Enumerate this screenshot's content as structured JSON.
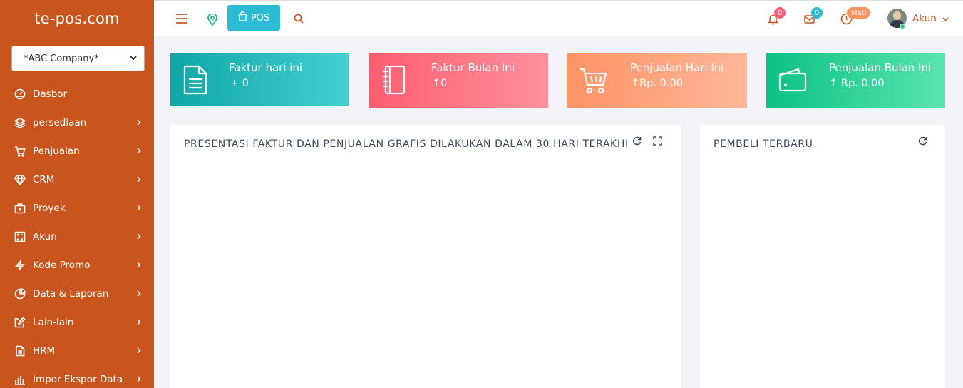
{
  "brand": "te-pos.com",
  "company_select": {
    "value": "*ABC Company*"
  },
  "sidebar": {
    "items": [
      {
        "label": "Dasbor",
        "icon": "dashboard-icon",
        "has_arrow": false
      },
      {
        "label": "persediaan",
        "icon": "layers-icon",
        "has_arrow": true
      },
      {
        "label": "Penjualan",
        "icon": "cart-icon",
        "has_arrow": true
      },
      {
        "label": "CRM",
        "icon": "diamond-icon",
        "has_arrow": true
      },
      {
        "label": "Proyek",
        "icon": "briefcase-icon",
        "has_arrow": true
      },
      {
        "label": "Akun",
        "icon": "calculator-icon",
        "has_arrow": true
      },
      {
        "label": "Kode Promo",
        "icon": "bolt-icon",
        "has_arrow": true
      },
      {
        "label": "Data & Laporan",
        "icon": "pie-chart-icon",
        "has_arrow": true
      },
      {
        "label": "Lain-lain",
        "icon": "edit-icon",
        "has_arrow": true
      },
      {
        "label": "HRM",
        "icon": "document-icon",
        "has_arrow": true
      },
      {
        "label": "Impor Ekspor Data",
        "icon": "bar-chart-icon",
        "has_arrow": true
      }
    ]
  },
  "topbar": {
    "pos_label": "POS",
    "notif_count": "0",
    "mail_count": "0",
    "clock_status": "Mati",
    "user_label": "Akun"
  },
  "stats": [
    {
      "title": "Faktur hari ini",
      "value": "+ 0"
    },
    {
      "title": "Faktur Bulan Ini",
      "value": "↑0"
    },
    {
      "title": "Penjualan Hari Ini",
      "value": "↑Rp. 0.00"
    },
    {
      "title": "Penjualan Bulan Ini",
      "value": "↑ Rp. 0.00"
    }
  ],
  "panels": {
    "chart_title": "PRESENTASI FAKTUR DAN PENJUALAN GRAFIS DILAKUKAN DALAM 30 HARI TERAKHIR",
    "buyers_title": "PEMBELI TERBARU"
  },
  "colors": {
    "sidebar": "#c9541e",
    "pos_button": "#2bbcd4",
    "stat1": [
      "#0fa6a6",
      "#45cfd0"
    ],
    "stat2": [
      "#fe5d70",
      "#fe909d"
    ],
    "stat3": [
      "#fe9365",
      "#feb798"
    ],
    "stat4": [
      "#0ac282",
      "#5be4b0"
    ]
  }
}
